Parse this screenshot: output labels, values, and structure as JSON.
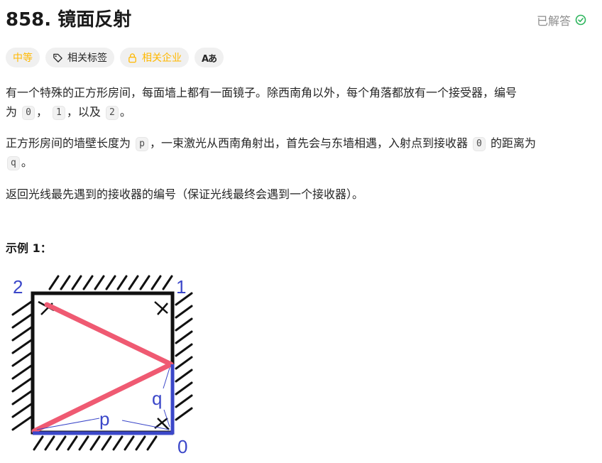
{
  "problem": {
    "title": "858. 镜面反射",
    "status_label": "已解答",
    "tags": {
      "difficulty": "中等",
      "related_tags": "相关标签",
      "related_companies": "相关企业",
      "translate_icon_text": "Aあ"
    },
    "paragraph1": {
      "text1": "有一个特殊的正方形房间，每面墙上都有一面镜子。除西南角以外，每个角落都放有一个接受器，编号",
      "text2": "为",
      "code0": "0",
      "sep1": "，",
      "code1": "1",
      "sep2": "，以及",
      "code2": "2",
      "end": "。"
    },
    "paragraph2": {
      "text1": "正方形房间的墙壁长度为",
      "code_p": "p",
      "text2": "，一束激光从西南角射出，首先会与东墙相遇，入射点到接收器",
      "code_0": "0",
      "text3": "的距离为",
      "code_q": "q",
      "end": "。"
    },
    "paragraph3": "返回光线最先遇到的接收器的编号（保证光线最终会遇到一个接收器）。",
    "example_title": "示例 1：",
    "figure": {
      "label_2": "2",
      "label_1": "1",
      "label_0": "0",
      "label_p": "p",
      "label_q": "q"
    }
  },
  "colors": {
    "difficulty": "#ffb800",
    "solved_check": "#2db55d",
    "laser": "#ef5a72",
    "label_blue": "#3b47c9"
  }
}
